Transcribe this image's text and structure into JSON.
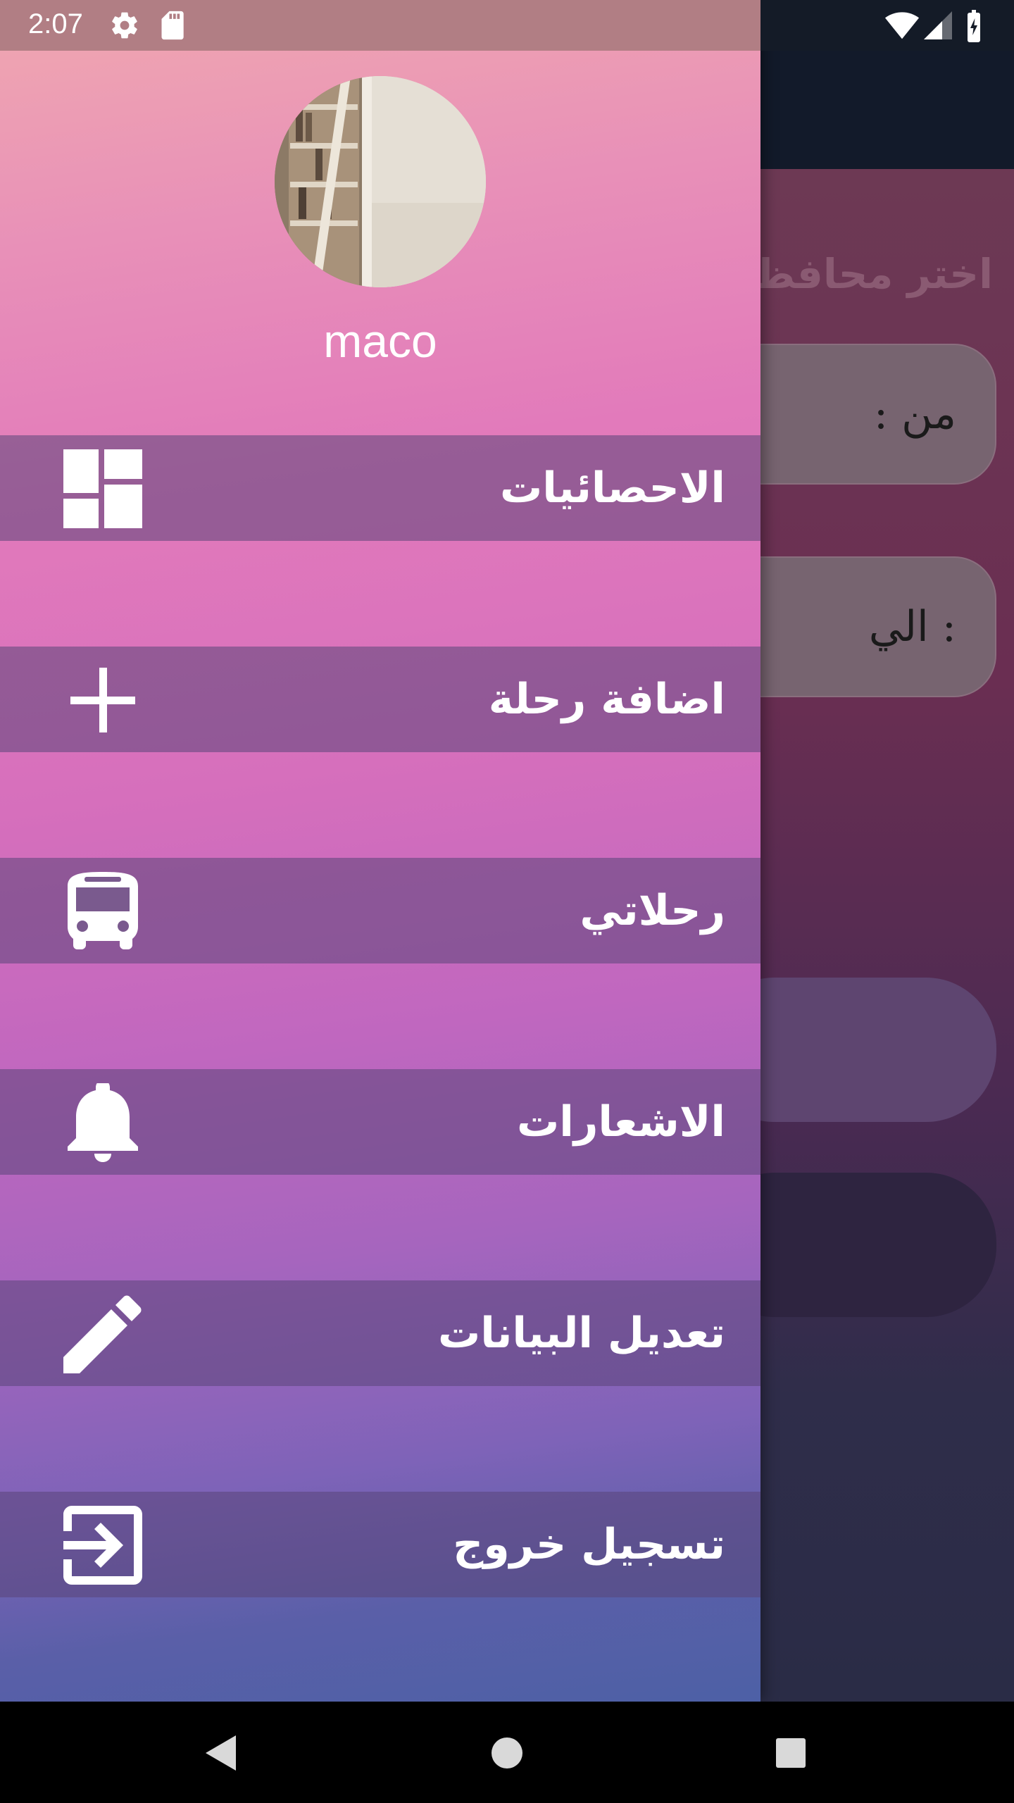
{
  "status_bar": {
    "time": "2:07"
  },
  "background_screen": {
    "title": "اختر محافظة",
    "from_label": "من :",
    "to_label": ": الي"
  },
  "drawer": {
    "user_name": "maco",
    "menu": [
      {
        "label": "الاحصائيات",
        "icon": "dashboard-icon"
      },
      {
        "label": "اضافة رحلة",
        "icon": "plus-icon"
      },
      {
        "label": "رحلاتي",
        "icon": "bus-icon"
      },
      {
        "label": "الاشعارات",
        "icon": "bell-icon"
      },
      {
        "label": "تعديل البيانات",
        "icon": "pencil-icon"
      },
      {
        "label": "تسجيل خروج",
        "icon": "exit-icon"
      }
    ]
  },
  "colors": {
    "drawer_gradient_top": "#f0a8b0",
    "drawer_gradient_middle": "#d66fbc",
    "drawer_gradient_bottom": "#4d60a6",
    "menu_item_background": "#5a4678",
    "app_bar": "#121a2a"
  }
}
